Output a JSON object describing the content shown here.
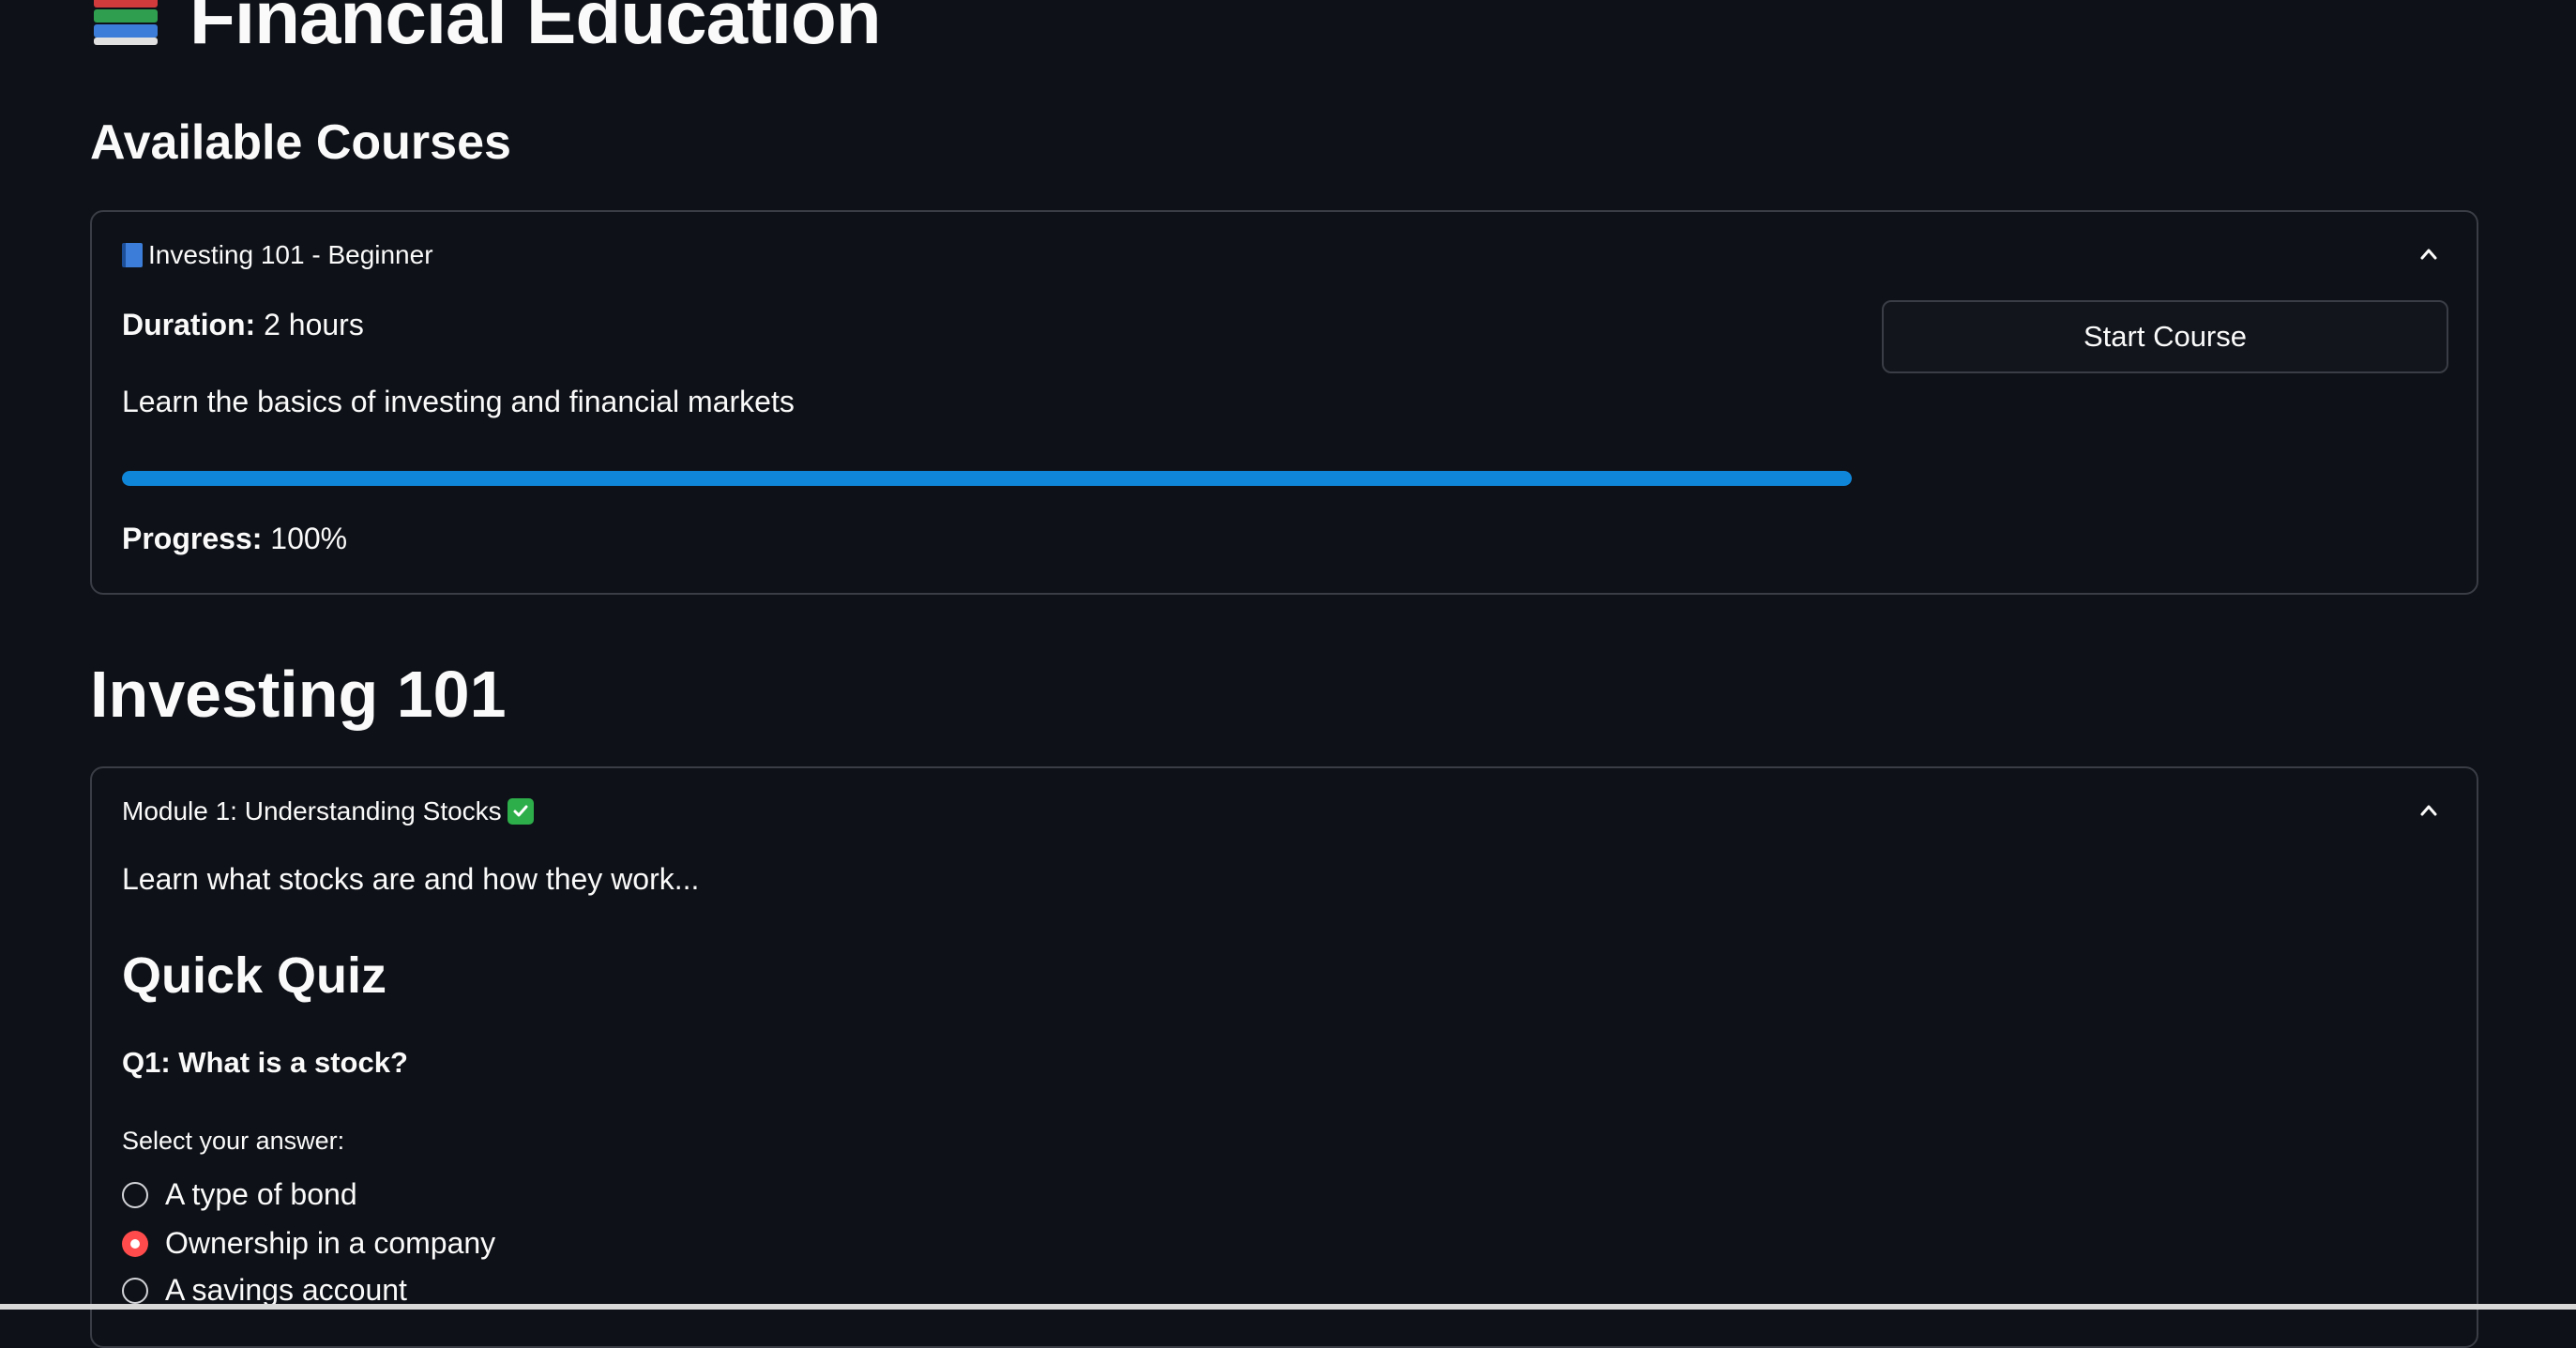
{
  "page": {
    "title": "Financial Education",
    "title_icon": "books-icon"
  },
  "courses": {
    "heading": "Available Courses",
    "items": [
      {
        "icon": "blue-book-icon",
        "header": "Investing 101 - Beginner",
        "duration_label": "Duration:",
        "duration_value": "2 hours",
        "description": "Learn the basics of investing and financial markets",
        "progress_fraction": 1.0,
        "progress_label": "Progress:",
        "progress_value": "100%",
        "button_label": "Start Course"
      }
    ]
  },
  "course_detail": {
    "title": "Investing 101",
    "modules": [
      {
        "header": "Module 1: Understanding Stocks",
        "status_icon": "check-mark-icon",
        "description": "Learn what stocks are and how they work...",
        "quiz_title": "Quick Quiz",
        "question": "Q1: What is a stock?",
        "select_label": "Select your answer:",
        "options": [
          {
            "label": "A type of bond",
            "selected": false
          },
          {
            "label": "Ownership in a company",
            "selected": true
          },
          {
            "label": "A savings account",
            "selected": false
          }
        ]
      }
    ]
  },
  "colors": {
    "background": "#0e1117",
    "progress": "#0f86d8",
    "radio_selected": "#ff4b4b",
    "check_badge": "#2dae4a"
  }
}
